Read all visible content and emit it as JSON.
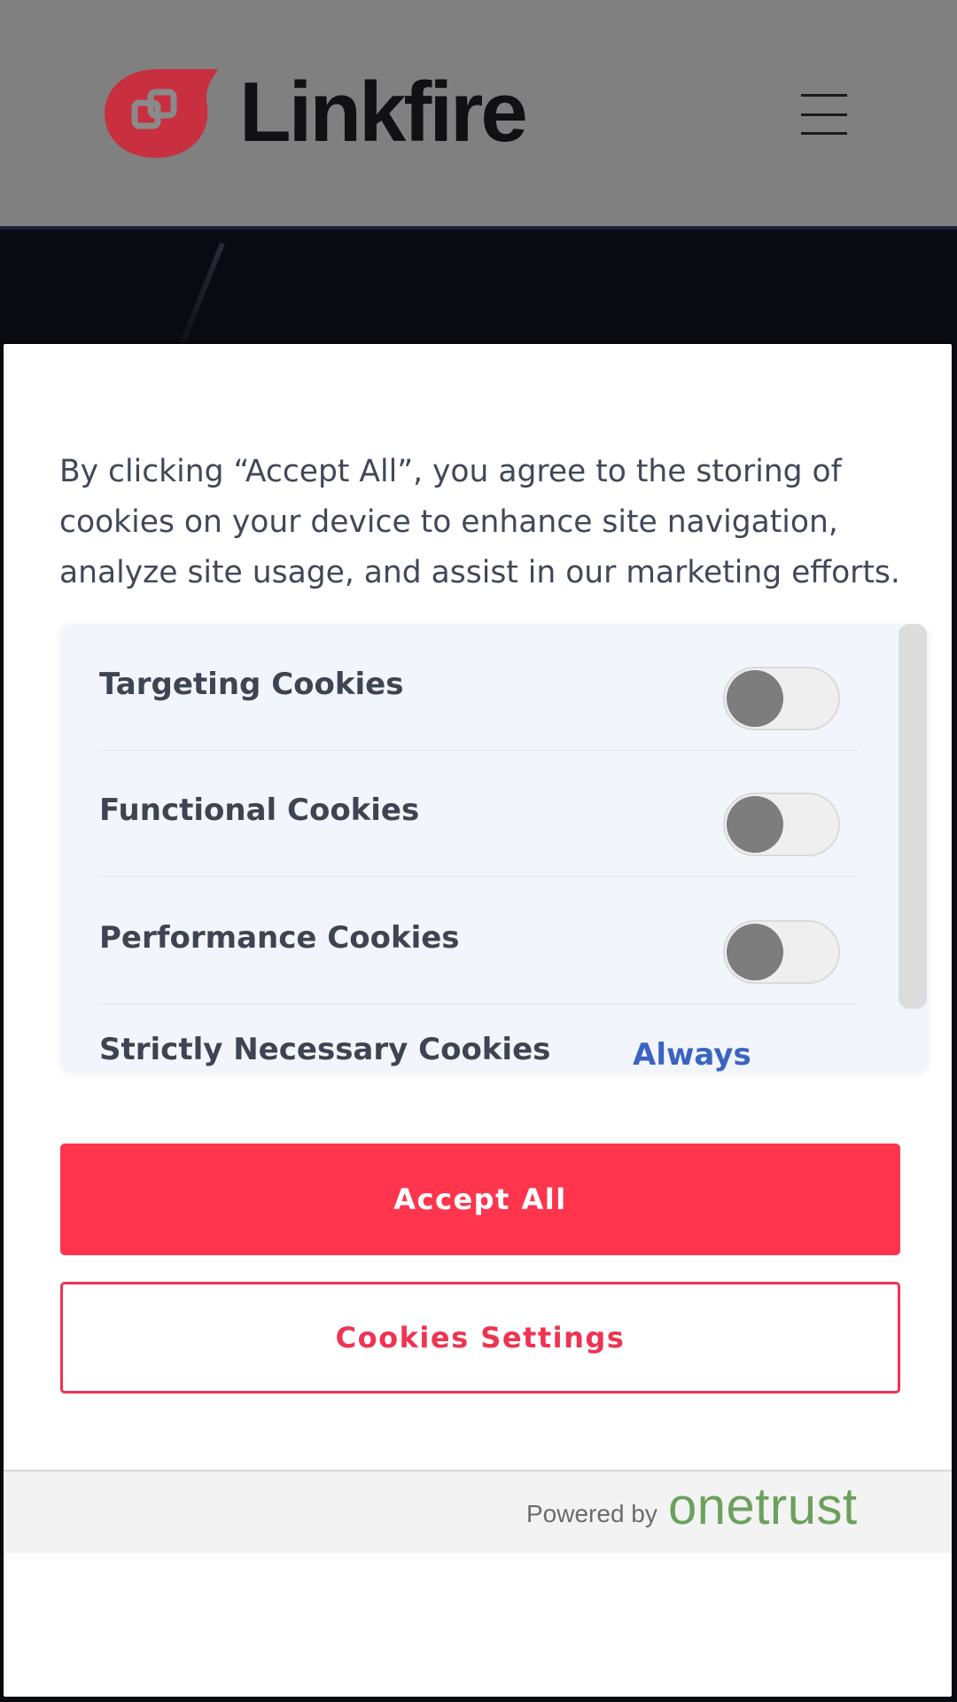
{
  "site": {
    "logo_text": "Linkfire",
    "brand_color": "#c8303f"
  },
  "cookie_banner": {
    "notice_text": "By clicking “Accept All”, you agree to the storing of cookies on your device to enhance site navigation, analyze site usage, and assist in our marketing efforts.",
    "preferences": [
      {
        "label": "Targeting Cookies",
        "enabled": false
      },
      {
        "label": "Functional Cookies",
        "enabled": false
      },
      {
        "label": "Performance Cookies",
        "enabled": false
      },
      {
        "label": "Strictly Necessary Cookies",
        "status": "Always Active"
      }
    ],
    "accept_all_label": "Accept All",
    "settings_label": "Cookies Settings",
    "accent_color": "#ff354d"
  },
  "footer": {
    "powered_by": "Powered by",
    "provider": "onetrust",
    "provider_color": "#6ca15d"
  },
  "icons": [
    "linkfire-logo-icon",
    "hamburger-menu-icon"
  ]
}
